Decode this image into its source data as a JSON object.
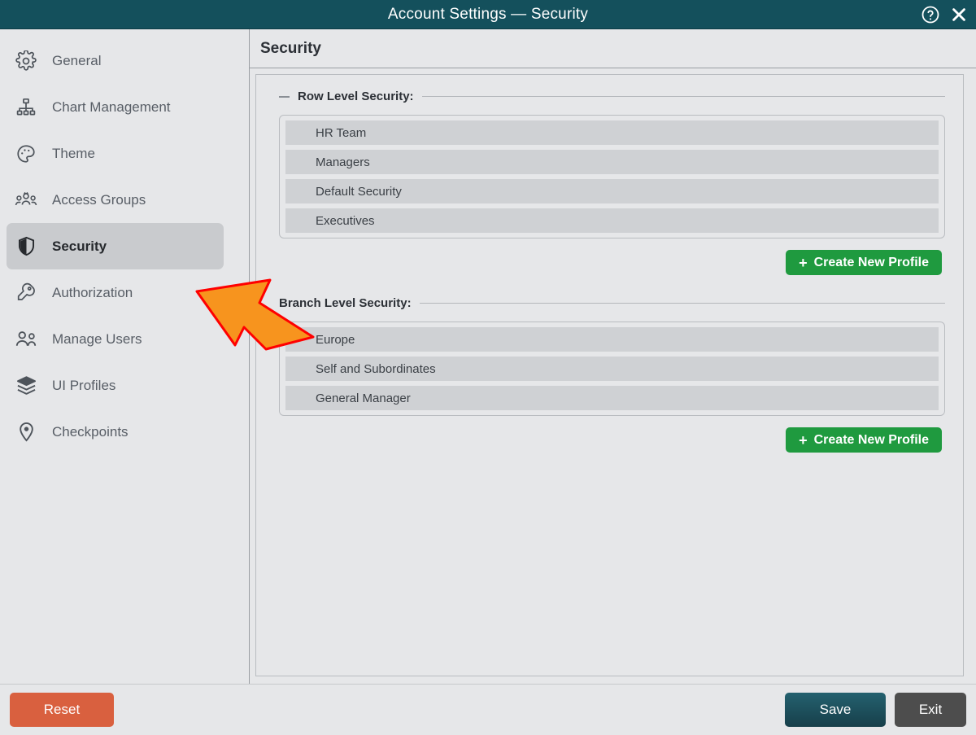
{
  "window": {
    "title": "Account Settings — Security",
    "help_icon": "help-circle-icon",
    "close_icon": "close-icon"
  },
  "sidebar": {
    "items": [
      {
        "label": "General",
        "icon": "gear-icon",
        "selected": false
      },
      {
        "label": "Chart Management",
        "icon": "org-chart-icon",
        "selected": false
      },
      {
        "label": "Theme",
        "icon": "palette-icon",
        "selected": false
      },
      {
        "label": "Access Groups",
        "icon": "user-group-icon",
        "selected": false
      },
      {
        "label": "Security",
        "icon": "shield-icon",
        "selected": true
      },
      {
        "label": "Authorization",
        "icon": "key-icon",
        "selected": false
      },
      {
        "label": "Manage Users",
        "icon": "two-users-icon",
        "selected": false
      },
      {
        "label": "UI Profiles",
        "icon": "layers-icon",
        "selected": false
      },
      {
        "label": "Checkpoints",
        "icon": "map-pin-icon",
        "selected": false
      }
    ]
  },
  "content": {
    "title": "Security",
    "sections": [
      {
        "title": "Row Level Security:",
        "items": [
          "HR Team",
          "Managers",
          "Default Security",
          "Executives"
        ],
        "button_label": "Create New Profile",
        "button_plus": "+"
      },
      {
        "title": "Branch Level Security:",
        "items": [
          "Europe",
          "Self and Subordinates",
          "General Manager"
        ],
        "button_label": "Create New Profile",
        "button_plus": "+"
      }
    ]
  },
  "footer": {
    "reset_label": "Reset",
    "save_label": "Save",
    "exit_label": "Exit"
  },
  "annotation": {
    "arrow": "arrow-pointer-up-left",
    "fill": "#F7941E",
    "stroke": "#FF0000"
  },
  "colors": {
    "titlebar": "#14505c",
    "panel_bg": "#e6e7e9",
    "list_item": "#cfd1d4",
    "accent_green": "#1f9a3f",
    "reset_orange": "#d9603f",
    "save_teal": "#1b4e5c",
    "exit_gray": "#4d4d4d",
    "selected_nav": "#c9cbce"
  }
}
